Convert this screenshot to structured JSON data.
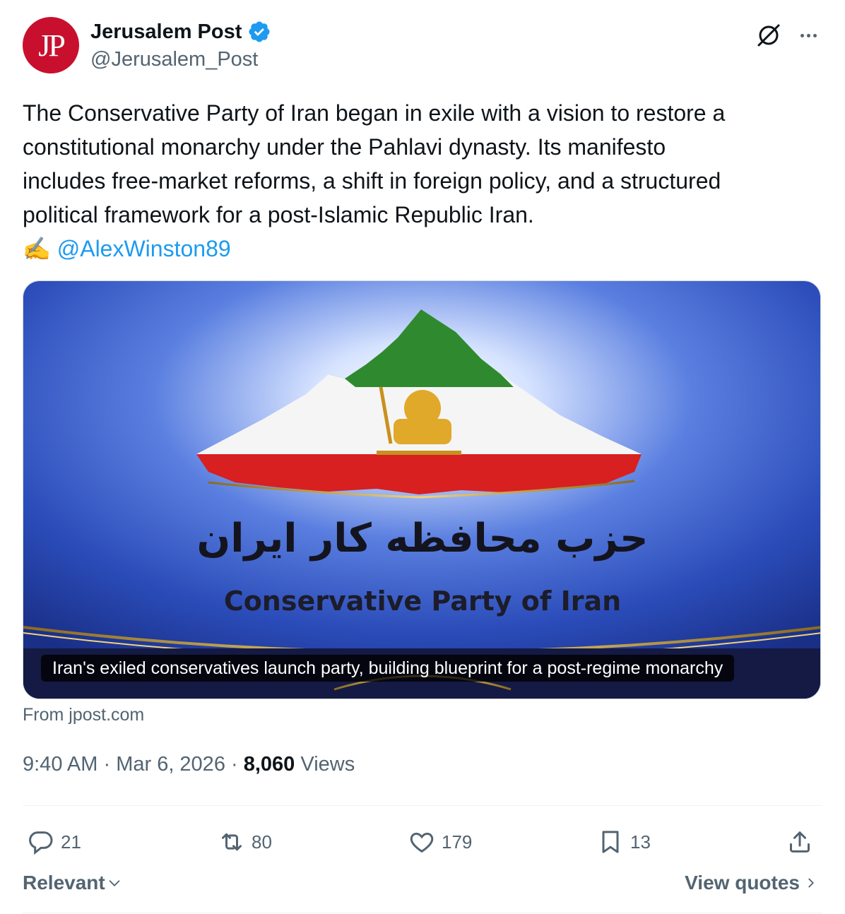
{
  "author": {
    "avatar_text": "JP",
    "display_name": "Jerusalem Post",
    "handle": "@Jerusalem_Post",
    "verified": true
  },
  "tweet": {
    "lines": [
      "The Conservative Party of Iran began in exile with a vision to restore a",
      "constitutional monarchy under the Pahlavi dynasty. Its manifesto",
      "includes free-market reforms, a shift in foreign policy, and a structured",
      "political framework for a post-Islamic Republic Iran."
    ],
    "pen_emoji": "✍️",
    "mention": "@AlexWinston89"
  },
  "card": {
    "persian_title": "حزب محافظه کار ایران",
    "english_title": "Conservative Party of Iran",
    "caption": "Iran's exiled conservatives launch party, building blueprint for a post-regime monarchy",
    "source": "From jpost.com"
  },
  "meta": {
    "time": "9:40 AM",
    "date": "Mar 6, 2026",
    "views_count": "8,060",
    "views_label": "Views"
  },
  "actions": {
    "replies": "21",
    "reposts": "80",
    "likes": "179",
    "bookmarks": "13"
  },
  "footer": {
    "sort_label": "Relevant",
    "view_quotes_label": "View quotes"
  },
  "colors": {
    "link": "#1d9bf0",
    "secondary_text": "#536471",
    "brand_red": "#c8102e"
  }
}
